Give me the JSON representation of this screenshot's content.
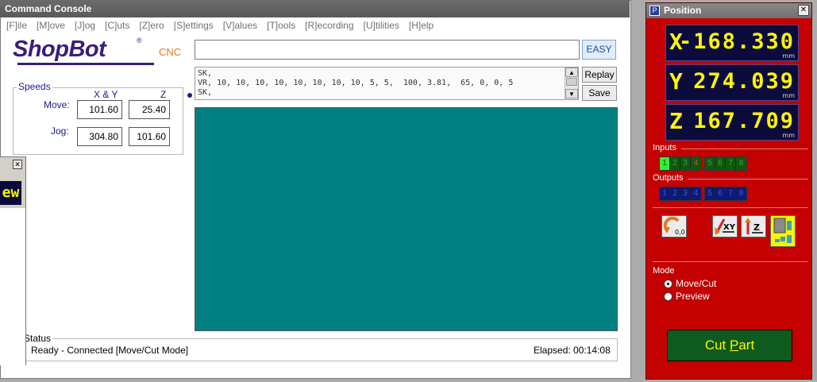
{
  "console": {
    "title": "Command Console",
    "menu": [
      "[F]ile",
      "[M]ove",
      "[J]og",
      "[C]uts",
      "[Z]ero",
      "[S]ettings",
      "[V]alues",
      "[T]ools",
      "[R]ecording",
      "[U]tilities",
      "[H]elp"
    ],
    "logo": {
      "brand": "ShopBot",
      "reg": "®",
      "suffix": "CNC"
    },
    "speeds": {
      "legend": "Speeds",
      "col_xy": "X & Y",
      "col_z": "Z",
      "move_label": "Move:",
      "jog_label": "Jog:",
      "move_xy": "101.60",
      "move_z": "25.40",
      "jog_xy": "304.80",
      "jog_z": "101.60"
    },
    "command_input": {
      "value": "",
      "placeholder": ""
    },
    "easy_label": "EASY",
    "history": "SK,\nVR, 10, 10, 10, 10, 10, 10, 10, 10, 5, 5,  100, 3.81,  65, 0, 0, 5\nSK,",
    "replay_label": "Replay",
    "save_label": "Save",
    "status": {
      "legend": "Status",
      "text": "Ready - Connected  [Move/Cut Mode]",
      "elapsed": "Elapsed: 00:14:08"
    }
  },
  "side_window": {
    "close": "✕",
    "display": "ew"
  },
  "position": {
    "title": "Position",
    "close": "✕",
    "icon": "P",
    "readouts": [
      {
        "axis": "X",
        "value": "-168.330",
        "unit": "mm"
      },
      {
        "axis": "Y",
        "value": "274.039",
        "unit": "mm"
      },
      {
        "axis": "Z",
        "value": "167.709",
        "unit": "mm"
      }
    ],
    "inputs_label": "Inputs",
    "inputs": [
      "1",
      "2",
      "3",
      "4",
      "5",
      "6",
      "7",
      "8"
    ],
    "inputs_active": [
      1
    ],
    "outputs_label": "Outputs",
    "outputs": [
      "1",
      "2",
      "3",
      "4",
      "5",
      "6",
      "7",
      "8"
    ],
    "tools": {
      "zero_label": "0,0",
      "xy_label": "XY",
      "z_label": "Z"
    },
    "mode_label": "Mode",
    "mode_options": [
      "Move/Cut",
      "Preview"
    ],
    "mode_selected": "Move/Cut",
    "cutpart_prefix": "Cut ",
    "cutpart_underline": "P",
    "cutpart_suffix": "art",
    "colors": {
      "panel": "#c40000",
      "readout_bg": "#0c0c3c",
      "readout_text": "#fff600",
      "cutpart_bg": "#0f5a1f"
    }
  }
}
